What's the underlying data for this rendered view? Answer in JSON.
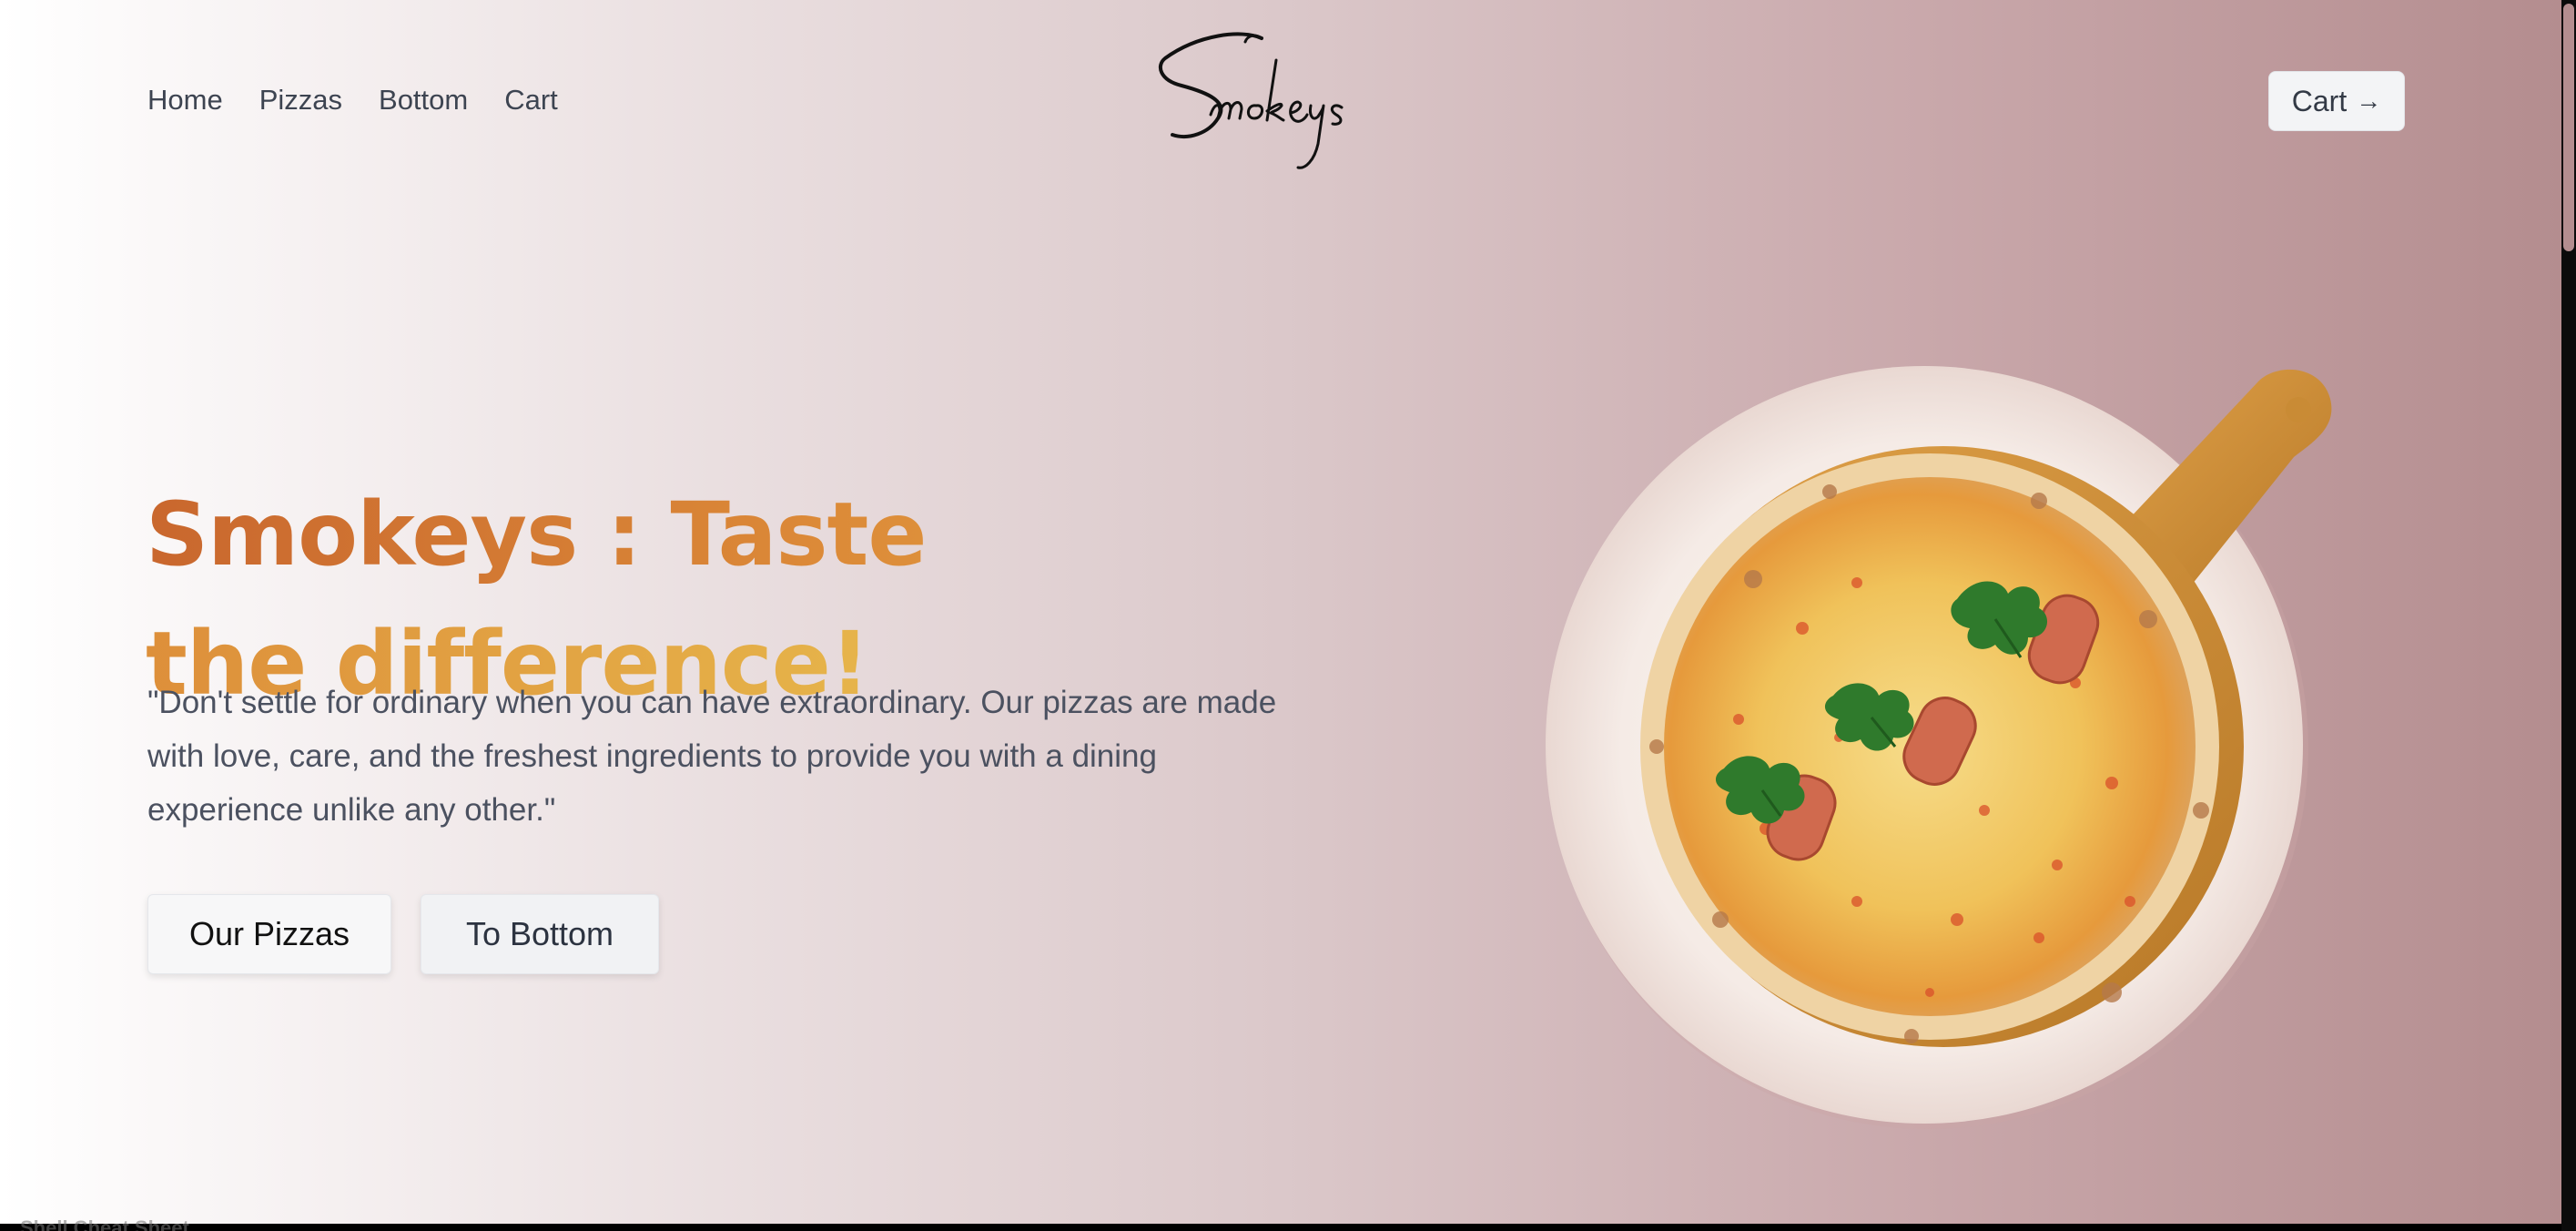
{
  "nav": {
    "items": [
      "Home",
      "Pizzas",
      "Bottom",
      "Cart"
    ]
  },
  "logo": {
    "text": "Smokeys"
  },
  "header": {
    "cart_label": "Cart",
    "cart_icon": "arrow-right-icon"
  },
  "hero": {
    "title": "Smokeys : Taste the difference!",
    "description": "\"Don't settle for ordinary when you can have extraordinary. Our pizzas are made with love, care, and the freshest ingredients to provide you with a dining experience unlike any other.\"",
    "primary_button": "Our Pizzas",
    "secondary_button": "To Bottom",
    "title_gradient": [
      "#c9672e",
      "#e6b44a"
    ]
  },
  "image": {
    "icon": "pizza-on-board-image"
  },
  "taskbar": {
    "text": "Shell Cheat Sheet"
  },
  "colors": {
    "background_start": "#ffffff",
    "background_end": "#b48d8f",
    "nav_text": "#3d4451",
    "body_text": "#4b5160"
  }
}
